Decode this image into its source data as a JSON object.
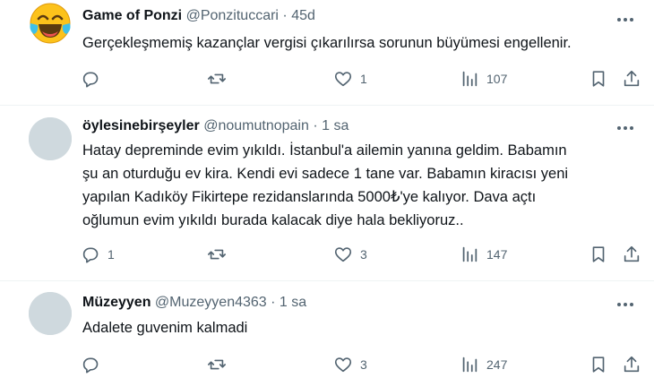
{
  "tweets": [
    {
      "name": "Game of Ponzi",
      "handle": "@Ponzituccari",
      "dot": "·",
      "time": "45d",
      "text": "Gerçekleşmemiş kazançlar vergisi çıkarılırsa sorunun büyümesi engellenir.",
      "avatar": "laughing-crying-emoji",
      "replies": "",
      "retweets": "",
      "likes": "1",
      "views": "107"
    },
    {
      "name": "öylesinebirşeyler",
      "handle": "@noumutnopain",
      "dot": "·",
      "time": "1 sa",
      "text": "Hatay depreminde evim yıkıldı. İstanbul'a ailemin yanına geldim. Babamın\nşu an oturduğu ev kira. Kendi evi sadece 1 tane var. Babamın kiracısı yeni\nyapılan Kadıköy Fikirtepe rezidanslarında 5000₺'ye kalıyor. Dava açtı\noğlumun evim yıkıldı burada kalacak diye hala bekliyoruz..",
      "avatar": "default-avatar",
      "replies": "1",
      "retweets": "",
      "likes": "3",
      "views": "147"
    },
    {
      "name": "Müzeyyen",
      "handle": "@Muzeyyen4363",
      "dot": "·",
      "time": "1 sa",
      "text": "Adalete guvenim kalmadi",
      "avatar": "default-avatar",
      "replies": "",
      "retweets": "",
      "likes": "3",
      "views": "247"
    }
  ],
  "colors": {
    "text": "#0f1419",
    "secondary": "#536471",
    "divider": "#eff3f4",
    "avatar_placeholder": "#cfd9de",
    "emoji": "#fcc21b"
  }
}
